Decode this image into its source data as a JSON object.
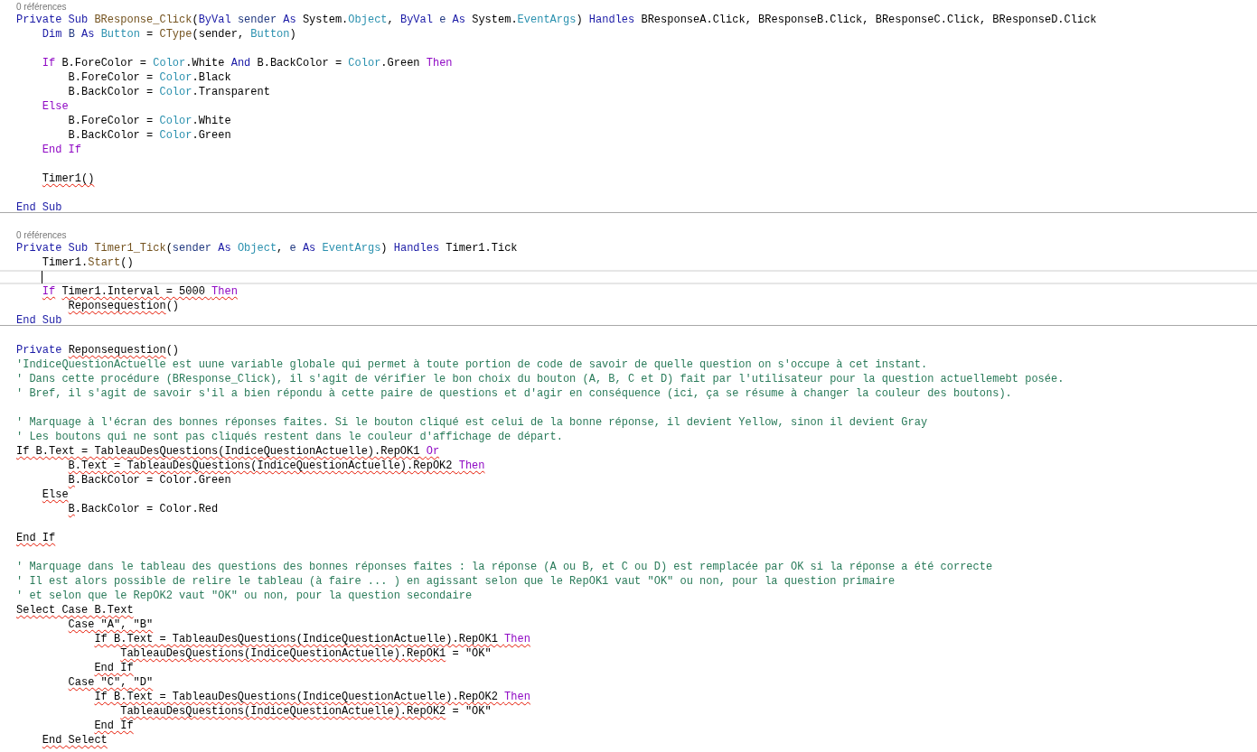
{
  "editor": {
    "lines": [
      {
        "kind": "codelens",
        "text": "0 références"
      },
      {
        "kind": "code",
        "current": false,
        "tokens": [
          {
            "text": "Private Sub ",
            "kind": "keyword",
            "squiggle": false
          },
          {
            "text": "BResponse_Click",
            "kind": "method",
            "squiggle": false
          },
          {
            "text": "(",
            "kind": "plain",
            "squiggle": false
          },
          {
            "text": "ByVal",
            "kind": "keyword",
            "squiggle": false
          },
          {
            "text": " sender ",
            "kind": "param",
            "squiggle": false
          },
          {
            "text": "As",
            "kind": "keyword",
            "squiggle": false
          },
          {
            "text": " System.",
            "kind": "plain",
            "squiggle": false
          },
          {
            "text": "Object",
            "kind": "type",
            "squiggle": false
          },
          {
            "text": ", ",
            "kind": "plain",
            "squiggle": false
          },
          {
            "text": "ByVal",
            "kind": "keyword",
            "squiggle": false
          },
          {
            "text": " e ",
            "kind": "param",
            "squiggle": false
          },
          {
            "text": "As",
            "kind": "keyword",
            "squiggle": false
          },
          {
            "text": " System.",
            "kind": "plain",
            "squiggle": false
          },
          {
            "text": "EventArgs",
            "kind": "type",
            "squiggle": false
          },
          {
            "text": ") ",
            "kind": "plain",
            "squiggle": false
          },
          {
            "text": "Handles",
            "kind": "keyword",
            "squiggle": false
          },
          {
            "text": " BResponseA.Click, BResponseB.Click, BResponseC.Click, BResponseD.Click",
            "kind": "plain",
            "squiggle": false
          }
        ]
      },
      {
        "kind": "code",
        "current": false,
        "tokens": [
          {
            "text": "    Dim",
            "kind": "keyword",
            "squiggle": false
          },
          {
            "text": " B ",
            "kind": "param",
            "squiggle": false
          },
          {
            "text": "As",
            "kind": "keyword",
            "squiggle": false
          },
          {
            "text": " Button",
            "kind": "type",
            "squiggle": false
          },
          {
            "text": " = ",
            "kind": "plain",
            "squiggle": false
          },
          {
            "text": "CType",
            "kind": "method",
            "squiggle": false
          },
          {
            "text": "(sender, ",
            "kind": "plain",
            "squiggle": false
          },
          {
            "text": "Button",
            "kind": "type",
            "squiggle": false
          },
          {
            "text": ")",
            "kind": "plain",
            "squiggle": false
          }
        ]
      },
      {
        "kind": "code",
        "current": false
      },
      {
        "kind": "code",
        "current": false,
        "tokens": [
          {
            "text": "    If",
            "kind": "control",
            "squiggle": false
          },
          {
            "text": " B.ForeColor = ",
            "kind": "plain",
            "squiggle": false
          },
          {
            "text": "Color",
            "kind": "type",
            "squiggle": false
          },
          {
            "text": ".White ",
            "kind": "plain",
            "squiggle": false
          },
          {
            "text": "And",
            "kind": "keyword",
            "squiggle": false
          },
          {
            "text": " B.BackColor = ",
            "kind": "plain",
            "squiggle": false
          },
          {
            "text": "Color",
            "kind": "type",
            "squiggle": false
          },
          {
            "text": ".Green ",
            "kind": "plain",
            "squiggle": false
          },
          {
            "text": "Then",
            "kind": "control",
            "squiggle": false
          }
        ]
      },
      {
        "kind": "code",
        "current": false,
        "tokens": [
          {
            "text": "        B.ForeColor = ",
            "kind": "plain",
            "squiggle": false
          },
          {
            "text": "Color",
            "kind": "type",
            "squiggle": false
          },
          {
            "text": ".Black",
            "kind": "plain",
            "squiggle": false
          }
        ]
      },
      {
        "kind": "code",
        "current": false,
        "tokens": [
          {
            "text": "        B.BackColor = ",
            "kind": "plain",
            "squiggle": false
          },
          {
            "text": "Color",
            "kind": "type",
            "squiggle": false
          },
          {
            "text": ".Transparent",
            "kind": "plain",
            "squiggle": false
          }
        ]
      },
      {
        "kind": "code",
        "current": false,
        "tokens": [
          {
            "text": "    Else",
            "kind": "control",
            "squiggle": false
          }
        ]
      },
      {
        "kind": "code",
        "current": false,
        "tokens": [
          {
            "text": "        B.ForeColor = ",
            "kind": "plain",
            "squiggle": false
          },
          {
            "text": "Color",
            "kind": "type",
            "squiggle": false
          },
          {
            "text": ".White",
            "kind": "plain",
            "squiggle": false
          }
        ]
      },
      {
        "kind": "code",
        "current": false,
        "tokens": [
          {
            "text": "        B.BackColor = ",
            "kind": "plain",
            "squiggle": false
          },
          {
            "text": "Color",
            "kind": "type",
            "squiggle": false
          },
          {
            "text": ".Green",
            "kind": "plain",
            "squiggle": false
          }
        ]
      },
      {
        "kind": "code",
        "current": false,
        "tokens": [
          {
            "text": "    End If",
            "kind": "control",
            "squiggle": false
          }
        ]
      },
      {
        "kind": "code",
        "current": false
      },
      {
        "kind": "code",
        "current": false,
        "tokens": [
          {
            "text": "    Timer1()",
            "kind": "plain",
            "squiggle": true
          }
        ]
      },
      {
        "kind": "code",
        "current": false
      },
      {
        "kind": "code",
        "current": false,
        "tokens": [
          {
            "text": "End Sub",
            "kind": "keyword",
            "squiggle": false
          }
        ]
      },
      {
        "kind": "separator"
      },
      {
        "kind": "codelens",
        "text": "0 références"
      },
      {
        "kind": "code",
        "current": false,
        "tokens": [
          {
            "text": "Private Sub ",
            "kind": "keyword",
            "squiggle": false
          },
          {
            "text": "Timer1_Tick",
            "kind": "method",
            "squiggle": false
          },
          {
            "text": "(",
            "kind": "plain",
            "squiggle": false
          },
          {
            "text": "sender ",
            "kind": "param",
            "squiggle": false
          },
          {
            "text": "As",
            "kind": "keyword",
            "squiggle": false
          },
          {
            "text": " Object",
            "kind": "type",
            "squiggle": false
          },
          {
            "text": ", ",
            "kind": "plain",
            "squiggle": false
          },
          {
            "text": "e ",
            "kind": "param",
            "squiggle": false
          },
          {
            "text": "As",
            "kind": "keyword",
            "squiggle": false
          },
          {
            "text": " EventArgs",
            "kind": "type",
            "squiggle": false
          },
          {
            "text": ") ",
            "kind": "plain",
            "squiggle": false
          },
          {
            "text": "Handles",
            "kind": "keyword",
            "squiggle": false
          },
          {
            "text": " Timer1.Tick",
            "kind": "plain",
            "squiggle": false
          }
        ]
      },
      {
        "kind": "code",
        "current": false,
        "tokens": [
          {
            "text": "    Timer1.",
            "kind": "plain",
            "squiggle": false
          },
          {
            "text": "Start",
            "kind": "method",
            "squiggle": false
          },
          {
            "text": "()",
            "kind": "plain",
            "squiggle": false
          }
        ]
      },
      {
        "kind": "code",
        "current": true
      },
      {
        "kind": "code",
        "current": false,
        "tokens": [
          {
            "text": "    If",
            "kind": "control",
            "squiggle": true
          },
          {
            "text": " Timer1.Interval = 5000 ",
            "kind": "plain",
            "squiggle": true
          },
          {
            "text": "Then",
            "kind": "control",
            "squiggle": true
          }
        ]
      },
      {
        "kind": "code",
        "current": false,
        "tokens": [
          {
            "text": "        Reponsequestion",
            "kind": "plain",
            "squiggle": true
          },
          {
            "text": "()",
            "kind": "plain",
            "squiggle": false
          }
        ]
      },
      {
        "kind": "code",
        "current": false,
        "tokens": [
          {
            "text": "End Sub",
            "kind": "keyword",
            "squiggle": false
          }
        ]
      },
      {
        "kind": "separator"
      },
      {
        "kind": "code",
        "current": false
      },
      {
        "kind": "code",
        "current": false,
        "tokens": [
          {
            "text": "Private",
            "kind": "keyword",
            "squiggle": false
          },
          {
            "text": " Reponsequestion",
            "kind": "plain",
            "squiggle": true
          },
          {
            "text": "()",
            "kind": "plain",
            "squiggle": false
          }
        ]
      },
      {
        "kind": "code",
        "current": false,
        "tokens": [
          {
            "text": "'IndiceQuestionActuelle est uune variable globale qui permet à toute portion de code de savoir de quelle question on s'occupe à cet instant.",
            "kind": "comment",
            "squiggle": false
          }
        ]
      },
      {
        "kind": "code",
        "current": false,
        "tokens": [
          {
            "text": "' Dans cette procédure (BResponse_Click), il s'agit de vérifier le bon choix du bouton (A, B, C et D) fait par l'utilisateur pour la question actuellemebt posée.",
            "kind": "comment",
            "squiggle": false
          }
        ]
      },
      {
        "kind": "code",
        "current": false,
        "tokens": [
          {
            "text": "' Bref, il s'agit de savoir s'il a bien répondu à cette paire de questions et d'agir en conséquence (ici, ça se résume à changer la couleur des boutons).",
            "kind": "comment",
            "squiggle": false
          }
        ]
      },
      {
        "kind": "code",
        "current": false
      },
      {
        "kind": "code",
        "current": false,
        "tokens": [
          {
            "text": "' Marquage à l'écran des bonnes réponses faites. Si le bouton cliqué est celui de la bonne réponse, il devient Yellow, sinon il devient Gray",
            "kind": "comment",
            "squiggle": false
          }
        ]
      },
      {
        "kind": "code",
        "current": false,
        "tokens": [
          {
            "text": "' Les boutons qui ne sont pas cliqués restent dans le couleur d'affichage de départ.",
            "kind": "comment",
            "squiggle": false
          }
        ]
      },
      {
        "kind": "code",
        "current": false,
        "tokens": [
          {
            "text": "If B.Text = TableauDesQuestions(IndiceQuestionActuelle).RepOK1 ",
            "kind": "plain",
            "squiggle": true
          },
          {
            "text": "Or",
            "kind": "control",
            "squiggle": true
          }
        ]
      },
      {
        "kind": "code",
        "current": false,
        "tokens": [
          {
            "text": "        B.Text = TableauDesQuestions(IndiceQuestionActuelle).RepOK2 ",
            "kind": "plain",
            "squiggle": true
          },
          {
            "text": "Then",
            "kind": "control",
            "squiggle": true
          }
        ]
      },
      {
        "kind": "code",
        "current": false,
        "tokens": [
          {
            "text": "        B",
            "kind": "plain",
            "squiggle": true
          },
          {
            "text": ".BackColor = Color.Green",
            "kind": "plain",
            "squiggle": false
          }
        ]
      },
      {
        "kind": "code",
        "current": false,
        "tokens": [
          {
            "text": "    Else",
            "kind": "plain",
            "squiggle": true
          }
        ]
      },
      {
        "kind": "code",
        "current": false,
        "tokens": [
          {
            "text": "        B",
            "kind": "plain",
            "squiggle": true
          },
          {
            "text": ".BackColor = Color.Red",
            "kind": "plain",
            "squiggle": false
          }
        ]
      },
      {
        "kind": "code",
        "current": false
      },
      {
        "kind": "code",
        "current": false,
        "tokens": [
          {
            "text": "End If",
            "kind": "plain",
            "squiggle": true
          }
        ]
      },
      {
        "kind": "code",
        "current": false
      },
      {
        "kind": "code",
        "current": false,
        "tokens": [
          {
            "text": "' Marquage dans le tableau des questions des bonnes réponses faites : la réponse (A ou B, et C ou D) est remplacée par OK si la réponse a été correcte",
            "kind": "comment",
            "squiggle": false
          }
        ]
      },
      {
        "kind": "code",
        "current": false,
        "tokens": [
          {
            "text": "' Il est alors possible de relire le tableau (à faire ... ) en agissant selon que le RepOK1 vaut \"OK\" ou non, pour la question primaire",
            "kind": "comment",
            "squiggle": false
          }
        ]
      },
      {
        "kind": "code",
        "current": false,
        "tokens": [
          {
            "text": "' et selon que le RepOK2 vaut \"OK\" ou non, pour la question secondaire",
            "kind": "comment",
            "squiggle": false
          }
        ]
      },
      {
        "kind": "code",
        "current": false,
        "tokens": [
          {
            "text": "Select Case B.Text",
            "kind": "plain",
            "squiggle": true
          }
        ]
      },
      {
        "kind": "code",
        "current": false,
        "tokens": [
          {
            "text": "        Case \"A\", \"B\"",
            "kind": "plain",
            "squiggle": true
          }
        ]
      },
      {
        "kind": "code",
        "current": false,
        "tokens": [
          {
            "text": "            If B.Text = TableauDesQuestions(IndiceQuestionActuelle).RepOK1 ",
            "kind": "plain",
            "squiggle": true
          },
          {
            "text": "Then",
            "kind": "control",
            "squiggle": true
          }
        ]
      },
      {
        "kind": "code",
        "current": false,
        "tokens": [
          {
            "text": "                TableauDesQuestions(IndiceQuestionActuelle).RepOK1",
            "kind": "plain",
            "squiggle": true
          },
          {
            "text": " = \"OK\"",
            "kind": "plain",
            "squiggle": false
          }
        ]
      },
      {
        "kind": "code",
        "current": false,
        "tokens": [
          {
            "text": "            End If",
            "kind": "plain",
            "squiggle": true
          }
        ]
      },
      {
        "kind": "code",
        "current": false,
        "tokens": [
          {
            "text": "        Case \"C\", \"D\"",
            "kind": "plain",
            "squiggle": true
          }
        ]
      },
      {
        "kind": "code",
        "current": false,
        "tokens": [
          {
            "text": "            If B.Text = TableauDesQuestions(IndiceQuestionActuelle).RepOK2 ",
            "kind": "plain",
            "squiggle": true
          },
          {
            "text": "Then",
            "kind": "control",
            "squiggle": true
          }
        ]
      },
      {
        "kind": "code",
        "current": false,
        "tokens": [
          {
            "text": "                TableauDesQuestions(IndiceQuestionActuelle).RepOK2",
            "kind": "plain",
            "squiggle": true
          },
          {
            "text": " = \"OK\"",
            "kind": "plain",
            "squiggle": false
          }
        ]
      },
      {
        "kind": "code",
        "current": false,
        "tokens": [
          {
            "text": "            End If",
            "kind": "plain",
            "squiggle": true
          }
        ]
      },
      {
        "kind": "code",
        "current": false,
        "tokens": [
          {
            "text": "    End Select",
            "kind": "plain",
            "squiggle": true
          }
        ]
      }
    ]
  }
}
